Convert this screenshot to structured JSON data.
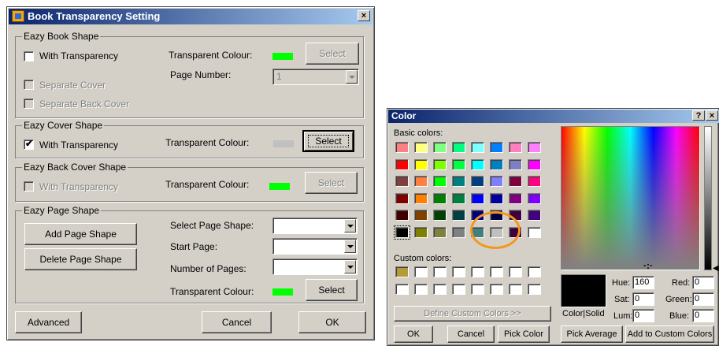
{
  "book_dialog": {
    "title": "Book Transparency Setting",
    "close_glyph": "×",
    "book_shape": {
      "legend": "Eazy Book Shape",
      "with_transparency": "With Transparency",
      "transparent_colour_label": "Transparent Colour:",
      "swatch_color": "#00ff00",
      "select_label": "Select",
      "page_number_label": "Page Number:",
      "page_number_value": "1",
      "separate_cover": "Separate Cover",
      "separate_back_cover": "Separate Back Cover"
    },
    "cover_shape": {
      "legend": "Eazy Cover Shape",
      "with_transparency": "With Transparency",
      "checked_mark": "✔",
      "transparent_colour_label": "Transparent Colour:",
      "swatch_color": "#c0c0c0",
      "select_label": "Select"
    },
    "back_cover_shape": {
      "legend": "Eazy Back Cover Shape",
      "with_transparency": "With Transparency",
      "transparent_colour_label": "Transparent Colour:",
      "swatch_color": "#00ff00",
      "select_label": "Select"
    },
    "page_shape": {
      "legend": "Eazy Page Shape",
      "add_button": "Add Page Shape",
      "delete_button": "Delete Page Shape",
      "select_page_shape_label": "Select Page Shape:",
      "start_page_label": "Start Page:",
      "number_of_pages_label": "Number of Pages:",
      "transparent_colour_label": "Transparent Colour:",
      "swatch_color": "#00ff00",
      "select_label": "Select"
    },
    "advanced_button": "Advanced",
    "cancel_button": "Cancel",
    "ok_button": "OK"
  },
  "color_dialog": {
    "title": "Color",
    "help_glyph": "?",
    "close_glyph": "×",
    "basic_colors_label": "Basic colors:",
    "basic_colors": [
      [
        "#ff8080",
        "#ffff80",
        "#80ff80",
        "#00ff80",
        "#80ffff",
        "#0080ff",
        "#ff80c0",
        "#ff80ff"
      ],
      [
        "#ff0000",
        "#ffff00",
        "#80ff00",
        "#00ff40",
        "#00ffff",
        "#0080c0",
        "#8080c0",
        "#ff00ff"
      ],
      [
        "#804040",
        "#ff8040",
        "#00ff00",
        "#008080",
        "#004080",
        "#8080ff",
        "#800040",
        "#ff0080"
      ],
      [
        "#800000",
        "#ff8000",
        "#008000",
        "#008040",
        "#0000ff",
        "#0000a0",
        "#800080",
        "#8000ff"
      ],
      [
        "#400000",
        "#804000",
        "#004000",
        "#004040",
        "#000080",
        "#000040",
        "#400040",
        "#400080"
      ],
      [
        "#000000",
        "#808000",
        "#808040",
        "#808080",
        "#408080",
        "#c0c0c0",
        "#400040",
        "#ffffff"
      ]
    ],
    "custom_colors_label": "Custom colors:",
    "custom_colors": [
      [
        "#b59a3a",
        "#ffffff",
        "#ffffff",
        "#ffffff",
        "#ffffff",
        "#ffffff",
        "#ffffff",
        "#ffffff"
      ],
      [
        "#ffffff",
        "#ffffff",
        "#ffffff",
        "#ffffff",
        "#ffffff",
        "#ffffff",
        "#ffffff",
        "#ffffff"
      ]
    ],
    "define_custom_button": "Define Custom Colors >>",
    "ok_button": "OK",
    "cancel_button": "Cancel",
    "pick_color_button": "Pick Color",
    "pick_average_button": "Pick Average",
    "add_custom_button": "Add to Custom Colors",
    "color_solid_label": "Color|Solid",
    "preview_color": "#000000",
    "hue_label": "Hue:",
    "hue_value": "160",
    "sat_label": "Sat:",
    "sat_value": "0",
    "lum_label": "Lum:",
    "lum_value": "0",
    "red_label": "Red:",
    "red_value": "0",
    "green_label": "Green:",
    "green_value": "0",
    "blue_label": "Blue:",
    "blue_value": "0",
    "highlight_color": "#f5961e"
  }
}
